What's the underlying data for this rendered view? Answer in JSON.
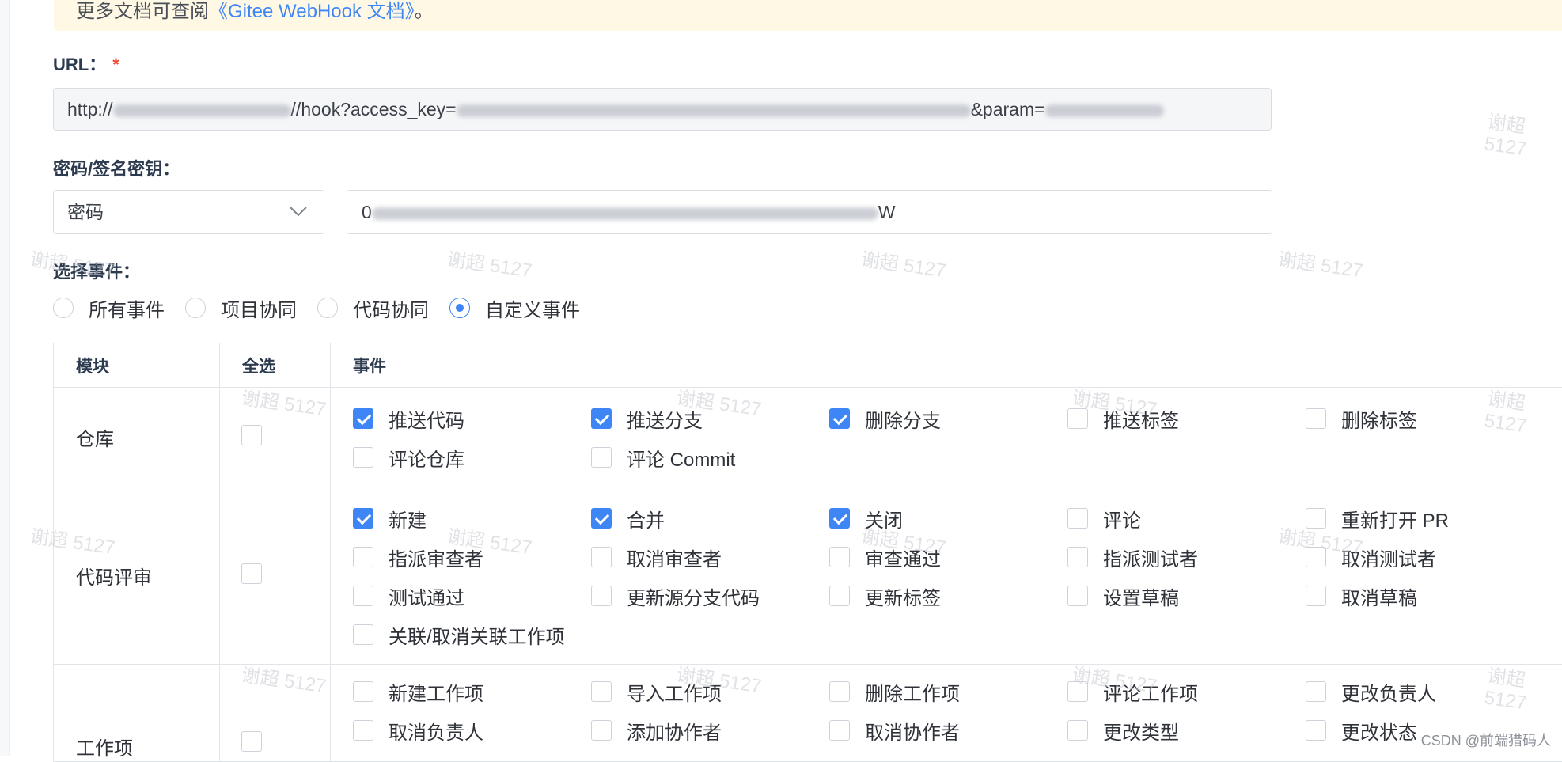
{
  "tip": {
    "prefix": "更多文档可查阅",
    "link": "《Gitee WebHook 文档》",
    "suffix": "。"
  },
  "url": {
    "label": "URL：",
    "required_mark": "*",
    "value_start": "http://",
    "value_mid": "//hook?access_key=",
    "value_end": "&param="
  },
  "secret": {
    "label": "密码/签名密钥：",
    "type_value": "密码",
    "value_start": "0",
    "value_end": "W"
  },
  "events_section": {
    "label": "选择事件：",
    "options": [
      {
        "label": "所有事件",
        "selected": false
      },
      {
        "label": "项目协同",
        "selected": false
      },
      {
        "label": "代码协同",
        "selected": false
      },
      {
        "label": "自定义事件",
        "selected": true
      }
    ]
  },
  "table": {
    "headers": [
      "模块",
      "全选",
      "事件"
    ],
    "rows": [
      {
        "module": "仓库",
        "select_all": false,
        "events": [
          {
            "label": "推送代码",
            "checked": true
          },
          {
            "label": "推送分支",
            "checked": true
          },
          {
            "label": "删除分支",
            "checked": true
          },
          {
            "label": "推送标签",
            "checked": false
          },
          {
            "label": "删除标签",
            "checked": false
          },
          {
            "label": "评论仓库",
            "checked": false
          },
          {
            "label": "评论 Commit",
            "checked": false
          }
        ]
      },
      {
        "module": "代码评审",
        "select_all": false,
        "events": [
          {
            "label": "新建",
            "checked": true
          },
          {
            "label": "合并",
            "checked": true
          },
          {
            "label": "关闭",
            "checked": true
          },
          {
            "label": "评论",
            "checked": false
          },
          {
            "label": "重新打开 PR",
            "checked": false
          },
          {
            "label": "指派审查者",
            "checked": false
          },
          {
            "label": "取消审查者",
            "checked": false
          },
          {
            "label": "审查通过",
            "checked": false
          },
          {
            "label": "指派测试者",
            "checked": false
          },
          {
            "label": "取消测试者",
            "checked": false
          },
          {
            "label": "测试通过",
            "checked": false
          },
          {
            "label": "更新源分支代码",
            "checked": false
          },
          {
            "label": "更新标签",
            "checked": false
          },
          {
            "label": "设置草稿",
            "checked": false
          },
          {
            "label": "取消草稿",
            "checked": false
          },
          {
            "label": "关联/取消关联工作项",
            "checked": false
          }
        ]
      },
      {
        "module": "工作项",
        "select_all": false,
        "events": [
          {
            "label": "新建工作项",
            "checked": false
          },
          {
            "label": "导入工作项",
            "checked": false
          },
          {
            "label": "删除工作项",
            "checked": false
          },
          {
            "label": "评论工作项",
            "checked": false
          },
          {
            "label": "更改负责人",
            "checked": false
          },
          {
            "label": "取消负责人",
            "checked": false
          },
          {
            "label": "添加协作者",
            "checked": false
          },
          {
            "label": "取消协作者",
            "checked": false
          },
          {
            "label": "更改类型",
            "checked": false
          },
          {
            "label": "更改状态",
            "checked": false
          }
        ]
      }
    ]
  },
  "watermark": "谢超 5127",
  "credit": "CSDN @前端猎码人"
}
